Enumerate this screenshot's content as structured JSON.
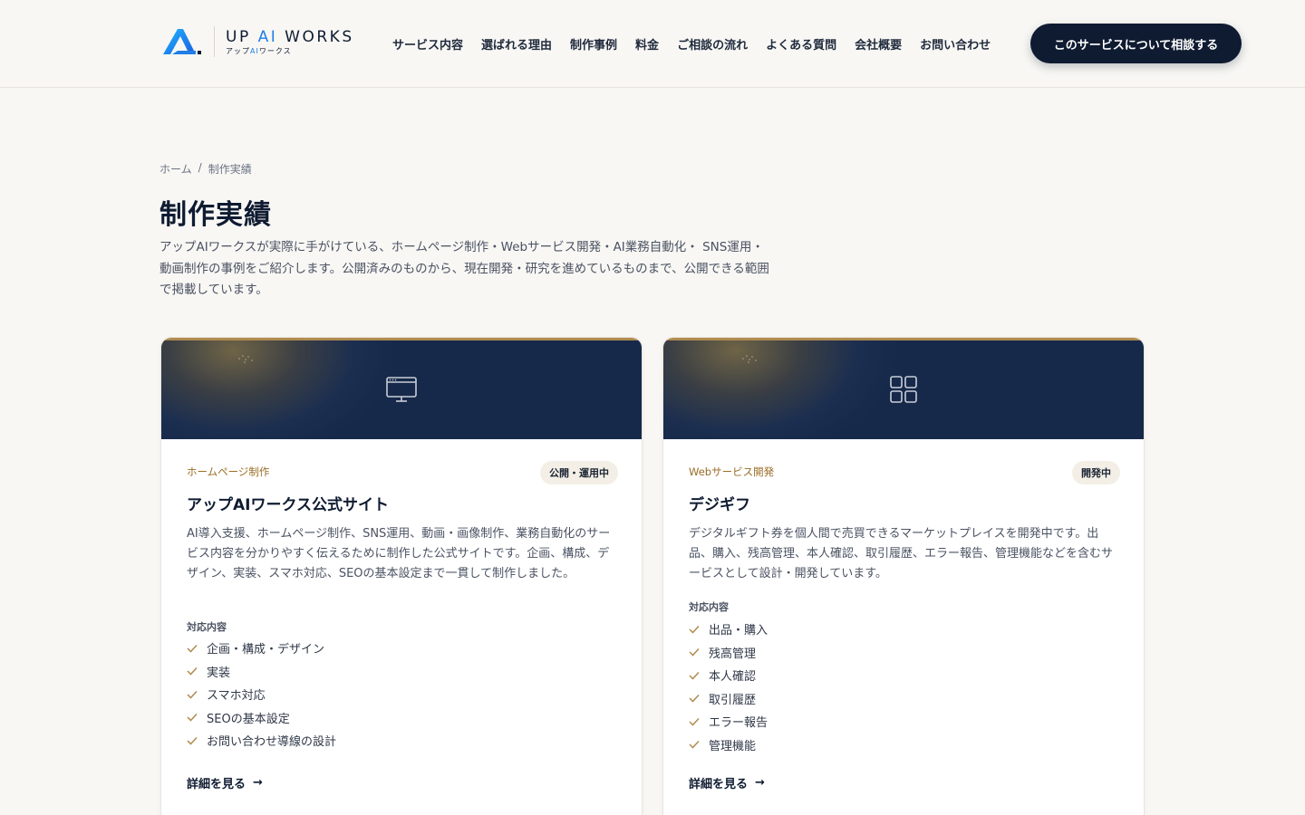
{
  "brand": {
    "name_prefix": "UP ",
    "name_ai": "AI",
    "name_suffix": " WORKS",
    "sub_prefix": "アップ",
    "sub_ai": "AI",
    "sub_suffix": "ワークス"
  },
  "nav": {
    "items": [
      {
        "label": "サービス内容"
      },
      {
        "label": "選ばれる理由"
      },
      {
        "label": "制作事例"
      },
      {
        "label": "料金"
      },
      {
        "label": "ご相談の流れ"
      },
      {
        "label": "よくある質問"
      },
      {
        "label": "会社概要"
      },
      {
        "label": "お問い合わせ"
      }
    ],
    "cta_label": "このサービスについて相談する"
  },
  "breadcrumb": {
    "home": "ホーム",
    "separator": "/",
    "current": "制作実績"
  },
  "page": {
    "title": "制作実績",
    "description": "アップAIワークスが実際に手がけている、ホームページ制作・Webサービス開発・AI業務自動化・ SNS運用・動画制作の事例をご紹介します。公開済みのものから、現在開発・研究を進めているものまで、公開できる範囲で掲載しています。"
  },
  "cards": [
    {
      "icon": "monitor-icon",
      "category": "ホームページ制作",
      "status": "公開・運用中",
      "title": "アップAIワークス公式サイト",
      "description": "AI導入支援、ホームページ制作、SNS運用、動画・画像制作、業務自動化のサービス内容を分かりやすく伝えるために制作した公式サイトです。企画、構成、デザイン、実装、スマホ対応、SEOの基本設定まで一貫して制作しました。",
      "features_label": "対応内容",
      "features": [
        "企画・構成・デザイン",
        "実装",
        "スマホ対応",
        "SEOの基本設定",
        "お問い合わせ導線の設計"
      ],
      "link_label": "詳細を見る"
    },
    {
      "icon": "grid-icon",
      "category": "Webサービス開発",
      "status": "開発中",
      "title": "デジギフ",
      "description": "デジタルギフト券を個人間で売買できるマーケットプレイスを開発中です。出品、購入、残高管理、本人確認、取引履歴、エラー報告、管理機能などを含むサービスとして設計・開発しています。",
      "features_label": "対応内容",
      "features": [
        "出品・購入",
        "残高管理",
        "本人確認",
        "取引履歴",
        "エラー報告",
        "管理機能"
      ],
      "link_label": "詳細を見る"
    }
  ],
  "colors": {
    "navy": "#0f1b31",
    "accent_gold": "#b08b4f",
    "brand_blue": "#1f7fe6",
    "background": "#f8f7f4"
  }
}
